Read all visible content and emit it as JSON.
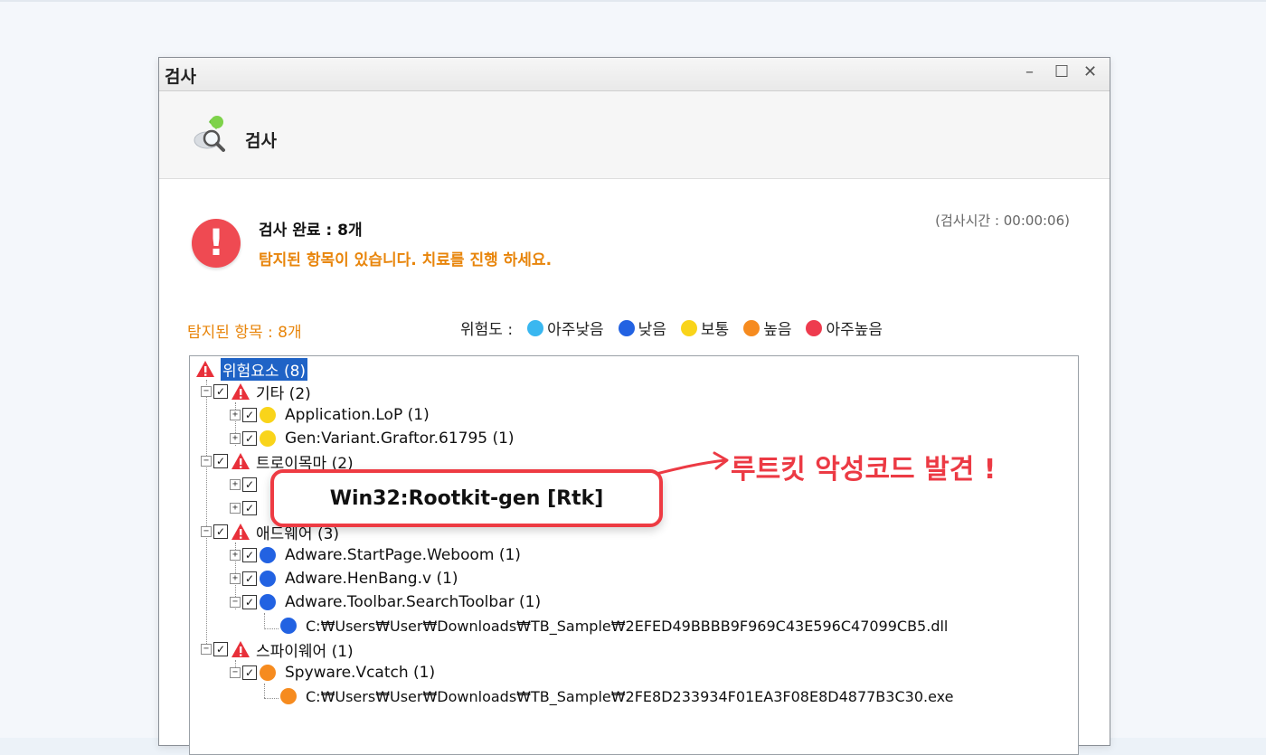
{
  "window": {
    "title": "검사",
    "controls": {
      "minimize": "–",
      "maximize": "☐",
      "close": "✕"
    }
  },
  "header": {
    "title": "검사",
    "icon": "scan-magnifier-icon"
  },
  "status": {
    "title": "검사 완료 : 8개",
    "message": "탐지된 항목이 있습니다. 치료를 진행 하세요.",
    "scan_time": "(검사시간 : 00:00:06)",
    "alert_symbol": "!"
  },
  "detected_count": "탐지된 항목 : 8개",
  "risk_legend": {
    "label": "위험도 :",
    "levels": [
      {
        "label": "아주낮음",
        "color": "#39b7f0"
      },
      {
        "label": "낮음",
        "color": "#2262e2"
      },
      {
        "label": "보통",
        "color": "#f9d41a"
      },
      {
        "label": "높음",
        "color": "#f68b1f"
      },
      {
        "label": "아주높음",
        "color": "#ee3b4e"
      }
    ]
  },
  "tree": {
    "root": "위험요소 (8)",
    "categories": [
      {
        "label": "기타 (2)",
        "items": [
          {
            "label": "Application.LoP (1)",
            "level": "보통",
            "color": "#f9d41a"
          },
          {
            "label": "Gen:Variant.Graftor.61795 (1)",
            "level": "보통",
            "color": "#f9d41a"
          }
        ]
      },
      {
        "label": "트로이목마 (2)"
      },
      {
        "label": "애드웨어 (3)",
        "items": [
          {
            "label": "Adware.StartPage.Weboom (1)",
            "level": "낮음",
            "color": "#2262e2"
          },
          {
            "label": "Adware.HenBang.v (1)",
            "level": "낮음",
            "color": "#2262e2"
          },
          {
            "label": "Adware.Toolbar.SearchToolbar (1)",
            "level": "낮음",
            "color": "#2262e2",
            "path": "C:₩Users₩User₩Downloads₩TB_Sample₩2EFED49BBBB9F969C43E596C47099CB5.dll"
          }
        ]
      },
      {
        "label": "스파이웨어 (1)",
        "items": [
          {
            "label": "Spyware.Vcatch (1)",
            "level": "높음",
            "color": "#f68b1f",
            "path": "C:₩Users₩User₩Downloads₩TB_Sample₩2FE8D233934F01EA3F08E8D4877B3C30.exe"
          }
        ]
      }
    ]
  },
  "callout": {
    "label": "Win32:Rootkit-gen [Rtk]",
    "note": "루트킷 악성코드 발견 !"
  },
  "colors": {
    "accent_orange": "#e8850b",
    "alert_red": "#ee3b43",
    "selection_blue": "#1f63c6"
  }
}
